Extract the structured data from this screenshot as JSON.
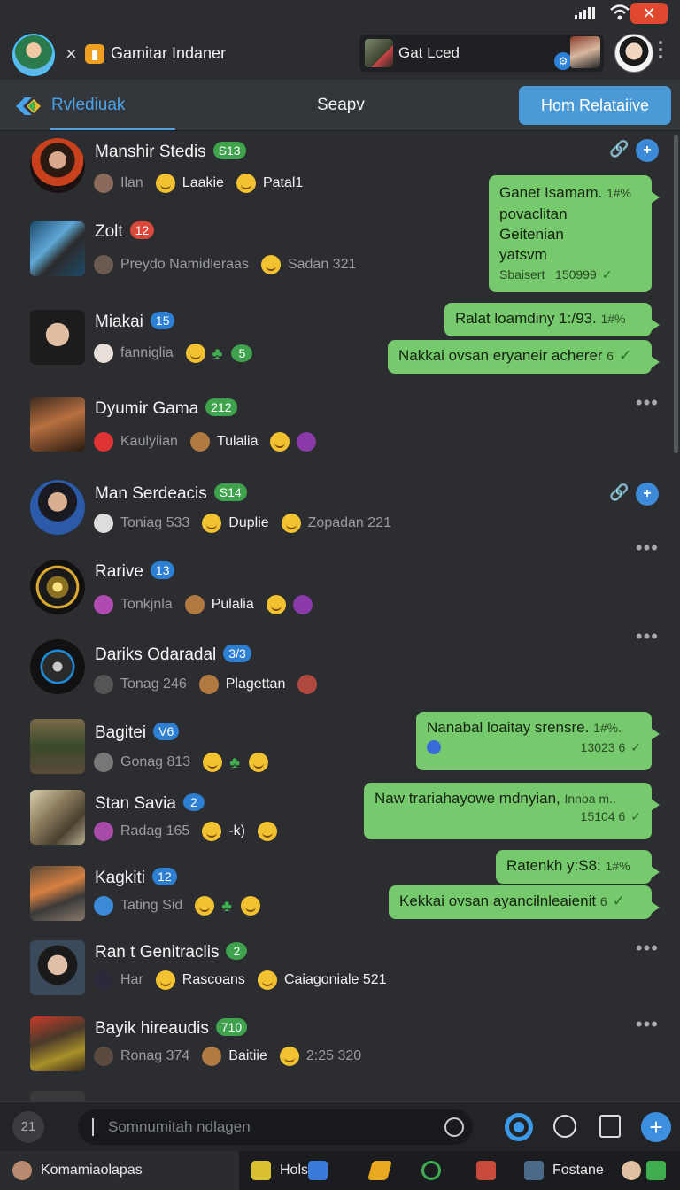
{
  "window": {
    "title": "Gamitar Indaner",
    "close_label": "✕",
    "chat_label": "Gat Lced",
    "tab_active": "Rvlediuak",
    "tab_center": "Seapv",
    "tab_button": "Hom Relataiive"
  },
  "contacts": [
    {
      "name": "Manshir Stedis",
      "badge": "S13",
      "sub": [
        "Ilan",
        "Laakie",
        "Patal1"
      ]
    },
    {
      "name": "Zolt",
      "badge": "12",
      "sub": [
        "Preydo Namidleraas",
        "Sadan 321"
      ]
    },
    {
      "name": "Miakai",
      "badge": "15",
      "sub": [
        "fanniglia",
        "5"
      ]
    },
    {
      "name": "Dyumir Gama",
      "badge": "212",
      "sub": [
        "Kaulyiian",
        "Tulalia"
      ]
    },
    {
      "name": "Man Serdeacis",
      "badge": "S14",
      "sub": [
        "Toniag 533",
        "Duplie",
        "Zopadan 221"
      ]
    },
    {
      "name": "Rarive",
      "badge": "13",
      "sub": [
        "Tonkjnla",
        "Pulalia"
      ]
    },
    {
      "name": "Dariks Odaradal",
      "badge": "3/3",
      "sub": [
        "Tonag 246",
        "Plagettan"
      ]
    },
    {
      "name": "Bagitei",
      "badge": "V6",
      "sub": [
        "Gonag 813"
      ]
    },
    {
      "name": "Stan Savia",
      "badge": "2",
      "sub": [
        "Radag 165",
        "-k)"
      ]
    },
    {
      "name": "Kagkiti",
      "badge": "12",
      "sub": [
        "Tating Sid"
      ]
    },
    {
      "name": "Ran t Genitraclis",
      "badge": "2",
      "sub": [
        "Har",
        "Rascoans",
        "Caiagoniale 521"
      ]
    },
    {
      "name": "Bayik hireaudis",
      "badge": "710",
      "sub": [
        "Ronag 374",
        "Baitiie",
        "2:25 320"
      ]
    }
  ],
  "messages": [
    {
      "lines": [
        "Ganet Isamam.",
        "povaclitan",
        "Geitenian",
        "yatsvm"
      ],
      "time_top": "1#%",
      "footer": "Sbaisert",
      "stamp": "150999"
    },
    {
      "lines": [
        "Ralat loamdiny 1:/93."
      ],
      "time_top": "1#%"
    },
    {
      "lines": [
        "Nakkai ovsan eryaneir acherer"
      ],
      "stamp": "6"
    },
    {
      "lines": [
        "Nanabal loaitay srensre."
      ],
      "time_top": "1#%.",
      "stamp": "13023 6"
    },
    {
      "lines": [
        "Naw trariahayowe mdnyian,"
      ],
      "time_top": "Innoa m..",
      "stamp": "15104 6"
    },
    {
      "lines": [
        "Ratenkh y:S8:"
      ],
      "time_top": "1#%"
    },
    {
      "lines": [
        "Kekkai ovsan ayancilnleaienit"
      ],
      "stamp": "6"
    }
  ],
  "composer": {
    "left": "21",
    "placeholder": "Somnumitah ndlagen"
  },
  "taskbar": {
    "first": "Komamiaolapas",
    "item2": "Holst",
    "item3": "Fostane"
  },
  "colors": {
    "accent": "#4aa3e8",
    "bubble": "#76c96d",
    "badge_green": "#3fa34d",
    "badge_blue": "#2d7fd3",
    "close": "#e0492f"
  }
}
